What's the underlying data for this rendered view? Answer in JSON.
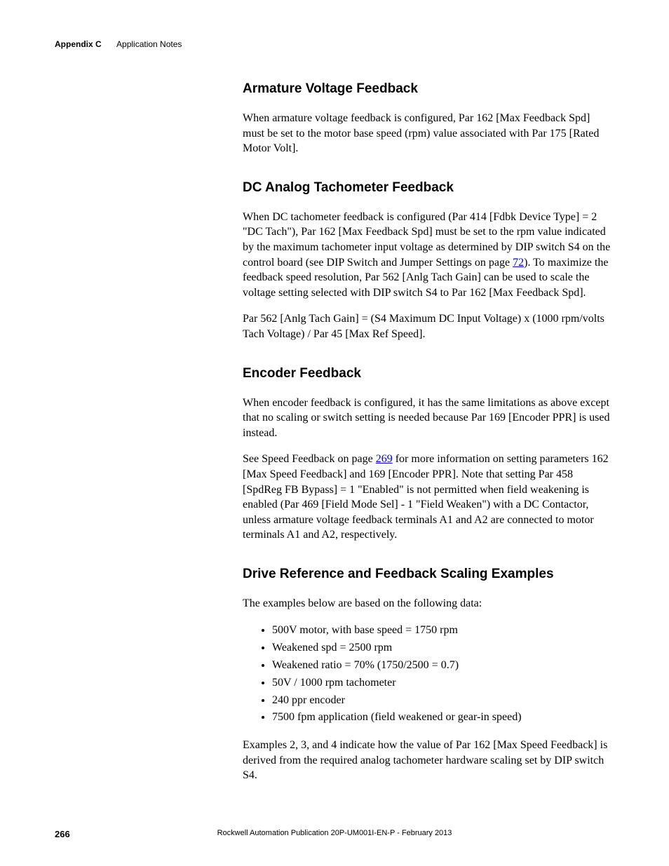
{
  "header": {
    "appendix": "Appendix C",
    "title": "Application Notes"
  },
  "sections": {
    "armature": {
      "heading": "Armature Voltage Feedback",
      "p1": "When armature voltage feedback is configured, Par 162 [Max Feedback Spd] must be set to the motor base speed (rpm) value associated with Par 175 [Rated Motor Volt]."
    },
    "dctach": {
      "heading": "DC Analog Tachometer Feedback",
      "p1a": "When DC tachometer feedback is configured (Par 414 [Fdbk Device Type] = 2 \"DC Tach\"), Par 162 [Max Feedback Spd] must be set to the rpm value indicated by the maximum tachometer input voltage as determined by DIP switch S4 on the control board (see DIP Switch and Jumper Settings on page ",
      "link1": "72",
      "p1b": "). To maximize the feedback speed resolution, Par 562 [Anlg Tach Gain] can be used to scale the voltage setting selected with DIP switch S4 to Par 162 [Max Feedback Spd].",
      "p2": "Par 562 [Anlg Tach Gain] = (S4 Maximum DC Input Voltage) x (1000 rpm/volts Tach Voltage) / Par 45 [Max Ref Speed]."
    },
    "encoder": {
      "heading": "Encoder Feedback",
      "p1": "When encoder feedback is configured, it has the same limitations as above except that no scaling or switch setting is needed because Par 169 [Encoder PPR] is used instead.",
      "p2a": "See Speed Feedback on page ",
      "link2": "269",
      "p2b": " for more information on setting parameters 162 [Max Speed Feedback] and 169 [Encoder PPR]. Note that setting Par 458 [SpdReg FB Bypass] = 1 \"Enabled\" is not permitted when field weakening is enabled (Par 469 [Field Mode Sel] - 1 \"Field Weaken\") with a DC Contactor, unless armature voltage feedback terminals A1 and A2 are connected to motor terminals A1 and A2, respectively."
    },
    "examples": {
      "heading": "Drive Reference and Feedback Scaling Examples",
      "intro": "The examples below are based on the following data:",
      "bullets": [
        "500V motor, with base speed = 1750 rpm",
        "Weakened spd = 2500 rpm",
        "Weakened ratio = 70% (1750/2500 = 0.7)",
        "50V / 1000 rpm tachometer",
        "240 ppr encoder",
        "7500 fpm application (field weakened or gear-in speed)"
      ],
      "p2": "Examples 2, 3, and 4 indicate how the value of Par 162 [Max Speed Feedback] is derived from the required analog tachometer hardware scaling set by DIP switch S4."
    }
  },
  "footer": {
    "pagenum": "266",
    "pubinfo": "Rockwell Automation Publication 20P-UM001I-EN-P - February 2013"
  }
}
